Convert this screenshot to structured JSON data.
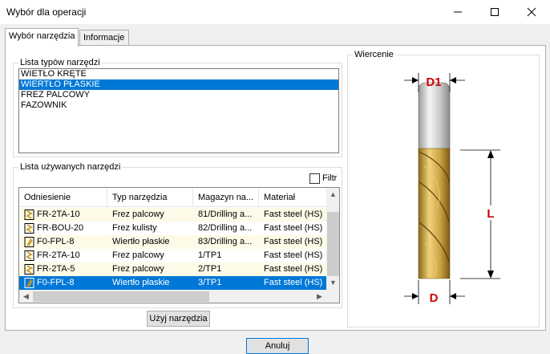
{
  "window": {
    "title": "Wybór dla operacji"
  },
  "tabs": [
    {
      "label": "Wybór narzędzia"
    },
    {
      "label": "Informacje"
    }
  ],
  "tool_types": {
    "label": "Lista typów narzędzi",
    "items": [
      "WIETŁO KRĘTE",
      "WIERTŁO PŁASKIE",
      "FREZ PALCOWY",
      "FAZOWNIK"
    ],
    "selected_index": 1
  },
  "used_tools": {
    "label": "Lista używanych narzędzi",
    "filter_label": "Filtr",
    "columns": [
      "Odniesienie",
      "Typ narzędzia",
      "Magazyn na...",
      "Materiał"
    ],
    "rows": [
      {
        "ref": "FR-2TA-10",
        "type": "Frez palcowy",
        "mag": "81/Drilling a...",
        "mat": "Fast steel (HS)",
        "icon": "endmill-icon"
      },
      {
        "ref": "FR-BOU-20",
        "type": "Frez kulisty",
        "mag": "82/Drilling a...",
        "mat": "Fast steel (HS)",
        "icon": "endmill-icon"
      },
      {
        "ref": "F0-FPL-8",
        "type": "Wiertło płaskie",
        "mag": "83/Drilling a...",
        "mat": "Fast steel (HS)",
        "icon": "flat-drill-icon"
      },
      {
        "ref": "FR-2TA-10",
        "type": "Frez palcowy",
        "mag": "1/TP1",
        "mat": "Fast steel (HS)",
        "icon": "endmill-icon"
      },
      {
        "ref": "FR-2TA-5",
        "type": "Frez palcowy",
        "mag": "2/TP1",
        "mat": "Fast steel (HS)",
        "icon": "endmill-icon"
      },
      {
        "ref": "F0-FPL-8",
        "type": "Wiertło płaskie",
        "mag": "3/TP1",
        "mat": "Fast steel (HS)",
        "icon": "flat-drill-icon"
      }
    ],
    "selected_index": 5
  },
  "use_tool_button": "Użyj narzędzia",
  "preview": {
    "label": "Wiercenie",
    "dim_d1": "D1",
    "dim_l": "L",
    "dim_d": "D",
    "dim_color": "#cc0000"
  },
  "cancel_button": "Anuluj"
}
